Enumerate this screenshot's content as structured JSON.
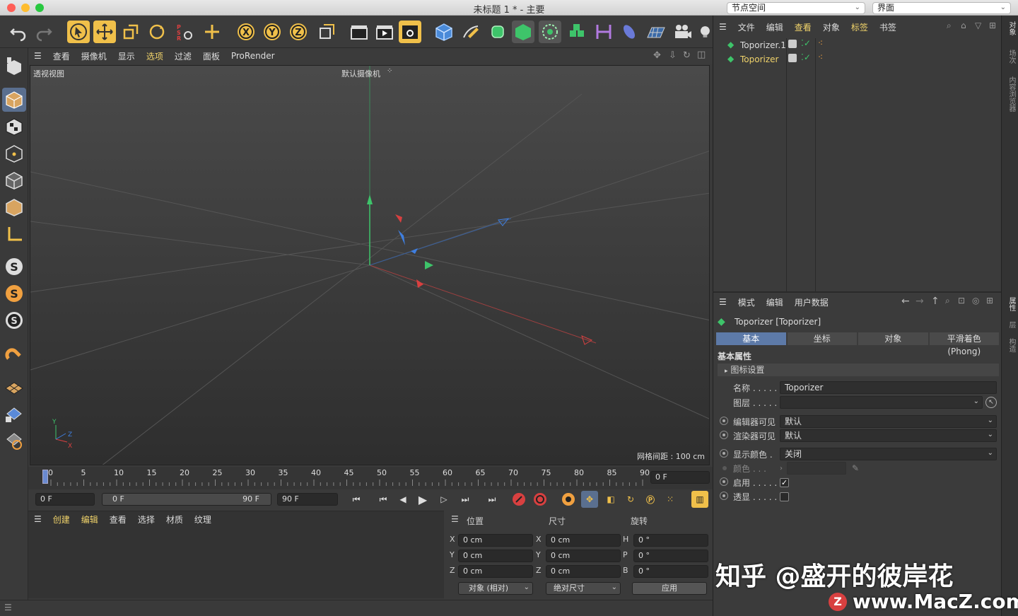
{
  "window": {
    "title": "未标题 1 * - 主要",
    "node_space": "节点空间",
    "layout": "界面"
  },
  "viewport_menu": [
    "查看",
    "摄像机",
    "显示",
    "选项",
    "过滤",
    "面板",
    "ProRender"
  ],
  "viewport": {
    "name": "透视视图",
    "camera": "默认摄像机",
    "grid_spacing": "网格间距 : 100 cm",
    "axis_x": "X",
    "axis_y": "Y",
    "axis_z": "Z"
  },
  "toolbar": {
    "axis_x": "X",
    "axis_y": "Y",
    "axis_z": "Z"
  },
  "timeline": {
    "ticks": [
      "0",
      "5",
      "10",
      "15",
      "20",
      "25",
      "30",
      "35",
      "40",
      "45",
      "50",
      "55",
      "60",
      "65",
      "70",
      "75",
      "80",
      "85",
      "90"
    ],
    "current_frame": "0 F"
  },
  "transport": {
    "start": "0 F",
    "range_start": "0 F",
    "range_end": "90 F",
    "end": "90 F"
  },
  "material_menu": [
    "创建",
    "编辑",
    "查看",
    "选择",
    "材质",
    "纹理"
  ],
  "coords": {
    "headers": {
      "position": "位置",
      "size": "尺寸",
      "rotation": "旋转"
    },
    "rows": [
      {
        "axis": "X",
        "pos": "0 cm",
        "saxis": "X",
        "size": "0 cm",
        "raxis": "H",
        "rot": "0 °"
      },
      {
        "axis": "Y",
        "pos": "0 cm",
        "saxis": "Y",
        "size": "0 cm",
        "raxis": "P",
        "rot": "0 °"
      },
      {
        "axis": "Z",
        "pos": "0 cm",
        "saxis": "Z",
        "size": "0 cm",
        "raxis": "B",
        "rot": "0 °"
      }
    ],
    "mode": "对象 (相对)",
    "size_mode": "绝对尺寸",
    "apply": "应用"
  },
  "object_manager": {
    "menu": [
      "文件",
      "编辑",
      "查看",
      "对象",
      "标签",
      "书签"
    ],
    "objects": [
      "Toporizer.1",
      "Toporizer"
    ]
  },
  "attributes": {
    "menu": [
      "模式",
      "编辑",
      "用户数据"
    ],
    "object_title": "Toporizer [Toporizer]",
    "tabs": [
      "基本",
      "坐标",
      "对象",
      "平滑着色 (Phong)"
    ],
    "section": "基本属性",
    "subsection": "图标设置",
    "name_label": "名称 . . . . .",
    "name_value": "Toporizer",
    "layer_label": "图层 . . . . .",
    "editor_visible_label": "编辑器可见",
    "editor_visible_value": "默认",
    "render_visible_label": "渲染器可见",
    "render_visible_value": "默认",
    "display_color_label": "显示颜色 .",
    "display_color_value": "关闭",
    "color_label": "颜色 . . .",
    "enable_label": "启用 . . . . .",
    "enable_checked": "✓",
    "xray_label": "透显 . . . . ."
  },
  "right_tabs": [
    "对象",
    "场次",
    "内容浏览器",
    "属性",
    "层",
    "构造"
  ],
  "watermarks": {
    "zhihu": "知乎 @盛开的彼岸花",
    "macz": "www.MacZ.com"
  },
  "colors": {
    "accent_yellow": "#f0d36a",
    "tab_active": "#5d7aa8",
    "x_axis": "#d84040",
    "y_axis": "#3ec46a",
    "z_axis": "#3f7fe0"
  }
}
